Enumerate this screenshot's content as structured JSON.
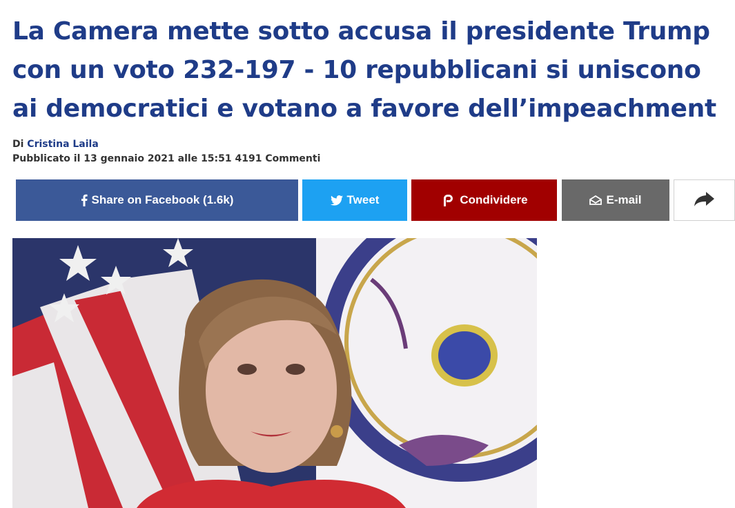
{
  "article": {
    "title": "La Camera mette sotto accusa il presidente Trump con un voto 232-197 - 10 repubblicani si uniscono ai democratici e votano a favore dell’impeachment",
    "byline_prefix": "Di",
    "author": "Cristina Laila",
    "published": "Pubblicato il 13 gennaio 2021 alle 15:51 4191 Commenti"
  },
  "share": {
    "facebook": {
      "label": "Share on Facebook (1.6k)",
      "icon": "facebook-icon",
      "color": "#3b5998"
    },
    "twitter": {
      "label": "Tweet",
      "icon": "twitter-bird-icon",
      "color": "#1da1f2"
    },
    "parler": {
      "label": "Condividere",
      "icon": "parler-icon",
      "color": "#a10000"
    },
    "email": {
      "label": "E-mail",
      "icon": "envelope-icon",
      "color": "#696969"
    },
    "more": {
      "icon": "share-arrow-icon"
    }
  },
  "image": {
    "icons": [
      "flag",
      "house-seal"
    ]
  },
  "colors": {
    "headline": "#1f3c88",
    "author": "#1f3c88"
  }
}
